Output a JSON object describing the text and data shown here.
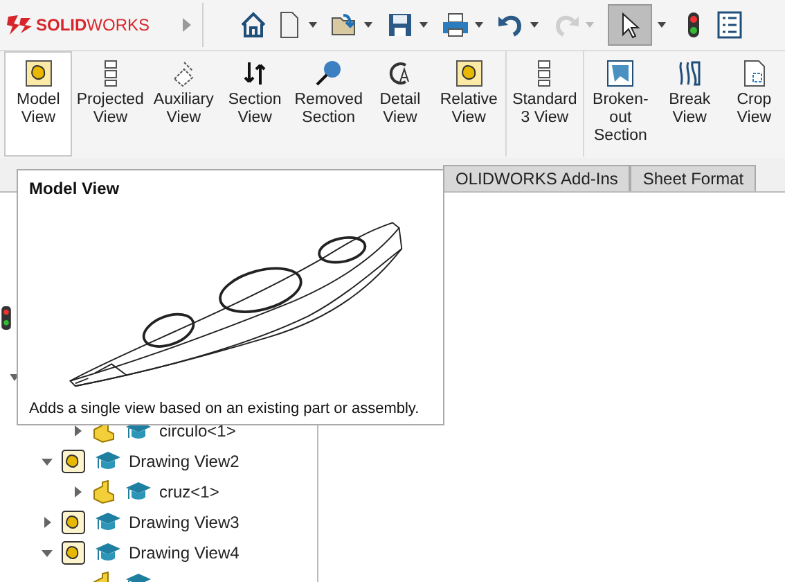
{
  "app": {
    "logo": "**SOLID**WORKS"
  },
  "toolbar": {
    "undo_disabled": false,
    "redo_disabled": true,
    "select_selected": true
  },
  "ribbon": [
    {
      "label": "Model View",
      "selected": true
    },
    {
      "label": "Projected View",
      "selected": false
    },
    {
      "label": "Auxiliary View",
      "selected": false
    },
    {
      "label": "Section View",
      "selected": false
    },
    {
      "label": "Removed Section",
      "selected": false
    },
    {
      "label": "Detail View",
      "selected": false
    },
    {
      "label": "Relative View",
      "selected": false
    },
    {
      "label": "Standard 3 View",
      "selected": false
    },
    {
      "label": "Broken-out Section",
      "selected": false
    },
    {
      "label": "Break View",
      "selected": false
    },
    {
      "label": "Crop View",
      "selected": false
    }
  ],
  "tabs": [
    {
      "label": "OLIDWORKS Add-Ins",
      "selected": false
    },
    {
      "label": "Sheet Format",
      "selected": false
    }
  ],
  "tooltip": {
    "title": "Model View",
    "description": "Adds a single view based on an existing part or assembly."
  },
  "tree": [
    {
      "kind": "part",
      "label": "circulo<1>",
      "expanded": false
    },
    {
      "kind": "view",
      "label": "Drawing View2",
      "expanded": true,
      "children": [
        {
          "kind": "part",
          "label": "cruz<1>",
          "expanded": false
        }
      ]
    },
    {
      "kind": "view",
      "label": "Drawing View3",
      "expanded": false
    },
    {
      "kind": "view",
      "label": "Drawing View4",
      "expanded": true,
      "children": [
        {
          "kind": "part"
        }
      ]
    }
  ]
}
